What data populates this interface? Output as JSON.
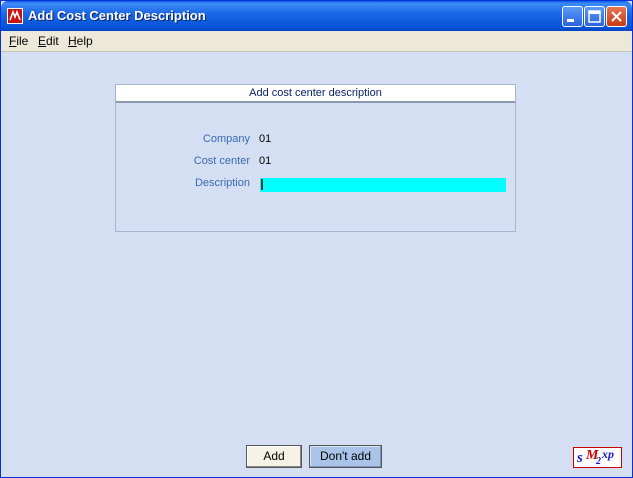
{
  "window": {
    "title": "Add Cost Center Description",
    "minimize_icon": "minimize-icon",
    "maximize_icon": "maximize-icon",
    "close_icon": "close-icon"
  },
  "menu": {
    "items": [
      {
        "label_ul": "F",
        "label_rest": "ile"
      },
      {
        "label_ul": "E",
        "label_rest": "dit"
      },
      {
        "label_ul": "H",
        "label_rest": "elp"
      }
    ]
  },
  "form": {
    "title": "Add cost center description",
    "fields": {
      "company": {
        "label": "Company",
        "value": "01"
      },
      "cost_center": {
        "label": "Cost center",
        "value": "01"
      },
      "description": {
        "label": "Description",
        "value": ""
      }
    }
  },
  "buttons": {
    "add": "Add",
    "dont_add": "Don't add"
  },
  "logo": {
    "text": "SM2xp"
  },
  "colors": {
    "window_bg": "#d4dff4",
    "field_highlight": "#00ffff",
    "label_text": "#3a68b0"
  }
}
